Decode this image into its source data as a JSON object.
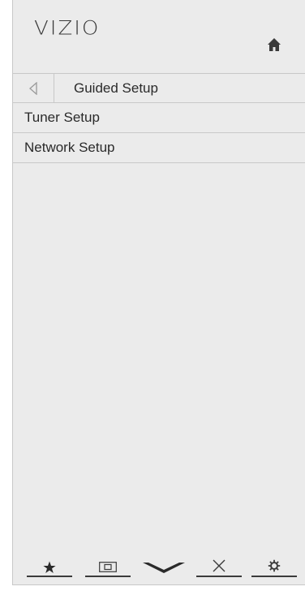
{
  "brand": {
    "logo": "VIZIO"
  },
  "header": {
    "title": "Guided Setup"
  },
  "menu": {
    "items": [
      {
        "label": "Tuner Setup"
      },
      {
        "label": "Network Setup"
      }
    ]
  },
  "icons": {
    "home": "home-icon",
    "back": "back-arrow-icon",
    "favorites": "star-icon",
    "input": "input-icon",
    "vizio": "vizio-v-icon",
    "exit": "close-icon",
    "settings": "gear-icon"
  },
  "colors": {
    "background": "#ebebeb",
    "text": "#2a2a2a",
    "divider": "#c8c8c8"
  }
}
